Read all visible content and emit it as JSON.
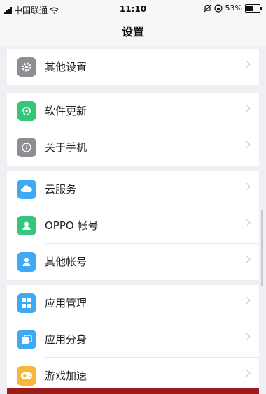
{
  "status_bar": {
    "carrier": "中国联通",
    "time": "11:10",
    "battery": "53%",
    "battery_level": 0.53
  },
  "header": {
    "title": "设置"
  },
  "groups": [
    {
      "items": [
        {
          "label": "其他设置",
          "icon": "gear-icon",
          "color": "#8e8e93"
        }
      ]
    },
    {
      "items": [
        {
          "label": "软件更新",
          "icon": "update-icon",
          "color": "#34c77b"
        },
        {
          "label": "关于手机",
          "icon": "info-icon",
          "color": "#8e8e93"
        }
      ]
    },
    {
      "items": [
        {
          "label": "云服务",
          "icon": "cloud-icon",
          "color": "#3fa9f5"
        },
        {
          "label": "OPPO 帐号",
          "icon": "account-icon",
          "color": "#34c77b"
        },
        {
          "label": "其他帐号",
          "icon": "person-icon",
          "color": "#3fa9f5"
        }
      ]
    },
    {
      "items": [
        {
          "label": "应用管理",
          "icon": "apps-grid-icon",
          "color": "#3fa9f5"
        },
        {
          "label": "应用分身",
          "icon": "app-clone-icon",
          "color": "#3fa9f5"
        },
        {
          "label": "游戏加速",
          "icon": "gamepad-icon",
          "color": "#f5b83d"
        }
      ]
    }
  ]
}
